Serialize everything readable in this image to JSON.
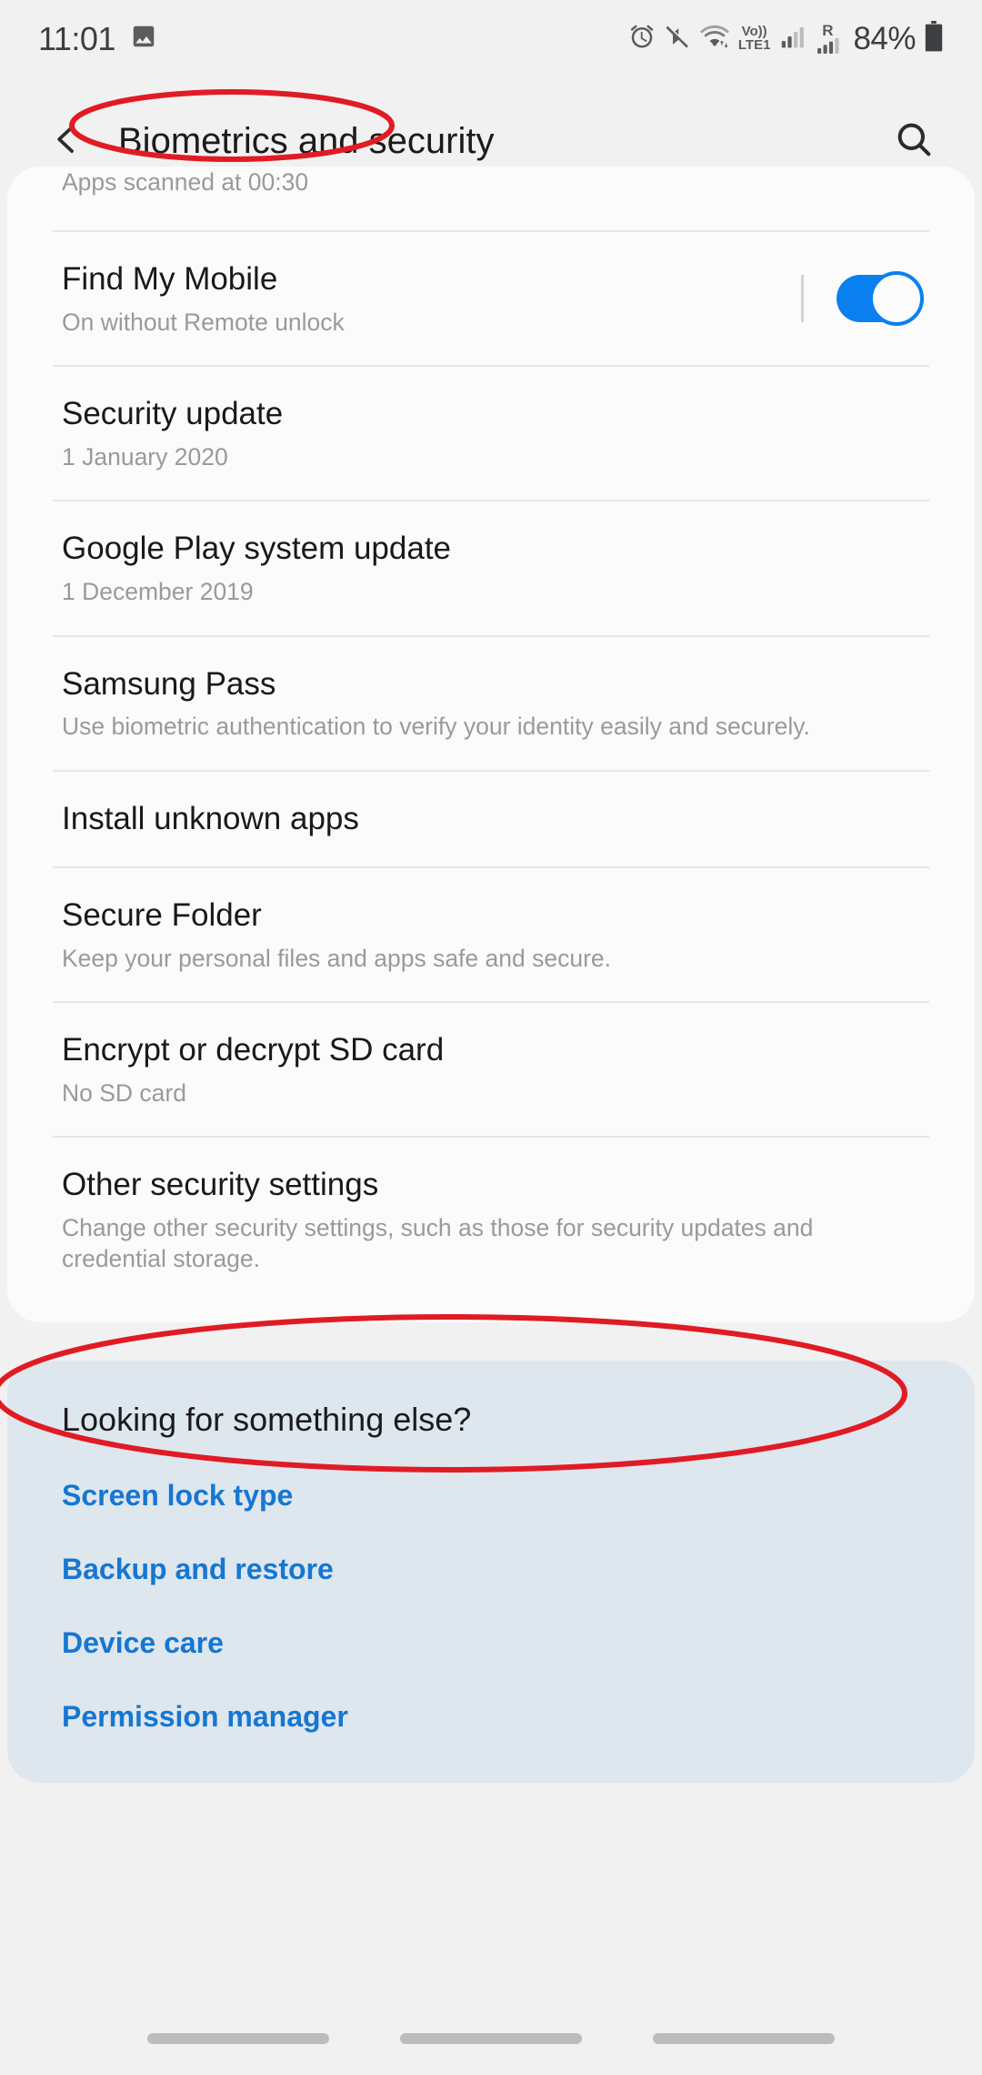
{
  "status_bar": {
    "time": "11:01",
    "battery_percent": "84%",
    "volte_top": "Vo))",
    "volte_bottom": "LTE1",
    "roaming_letter": "R",
    "icons": [
      "image-icon",
      "alarm-icon",
      "mute-icon",
      "wifi-icon",
      "volte-icon",
      "signal-icon",
      "roaming-signal-icon",
      "battery-icon"
    ]
  },
  "app_bar": {
    "title": "Biometrics and security",
    "back_icon": "back-chevron-icon",
    "search_icon": "search-icon"
  },
  "settings_card": {
    "partial_row": {
      "subtitle": "Apps scanned at 00:30"
    },
    "rows": [
      {
        "title": "Find My Mobile",
        "subtitle": "On without Remote unlock",
        "has_toggle": true,
        "toggle_on": true
      },
      {
        "title": "Security update",
        "subtitle": "1 January 2020",
        "has_toggle": false
      },
      {
        "title": "Google Play system update",
        "subtitle": "1 December 2019",
        "has_toggle": false
      },
      {
        "title": "Samsung Pass",
        "subtitle": "Use biometric authentication to verify your identity easily and securely.",
        "has_toggle": false
      },
      {
        "title": "Install unknown apps",
        "subtitle": "",
        "has_toggle": false
      },
      {
        "title": "Secure Folder",
        "subtitle": "Keep your personal files and apps safe and secure.",
        "has_toggle": false
      },
      {
        "title": "Encrypt or decrypt SD card",
        "subtitle": "No SD card",
        "has_toggle": false
      },
      {
        "title": "Other security settings",
        "subtitle": "Change other security settings, such as those for security updates and credential storage.",
        "has_toggle": false
      }
    ]
  },
  "suggestions": {
    "title": "Looking for something else?",
    "links": [
      "Screen lock type",
      "Backup and restore",
      "Device care",
      "Permission manager"
    ]
  },
  "navigation_bar": {
    "pills": 3
  },
  "annotations": {
    "color": "#e01b24",
    "ellipses": [
      {
        "target": "Biometrics and security"
      },
      {
        "target": "Other security settings"
      }
    ]
  },
  "colors": {
    "accent_blue": "#0a80f0",
    "link_blue": "#1577d2",
    "page_bg": "#f1f1f1",
    "card_bg": "#fbfbfb",
    "suggestion_bg": "#dee6ee",
    "annotation_red": "#e01b24"
  }
}
